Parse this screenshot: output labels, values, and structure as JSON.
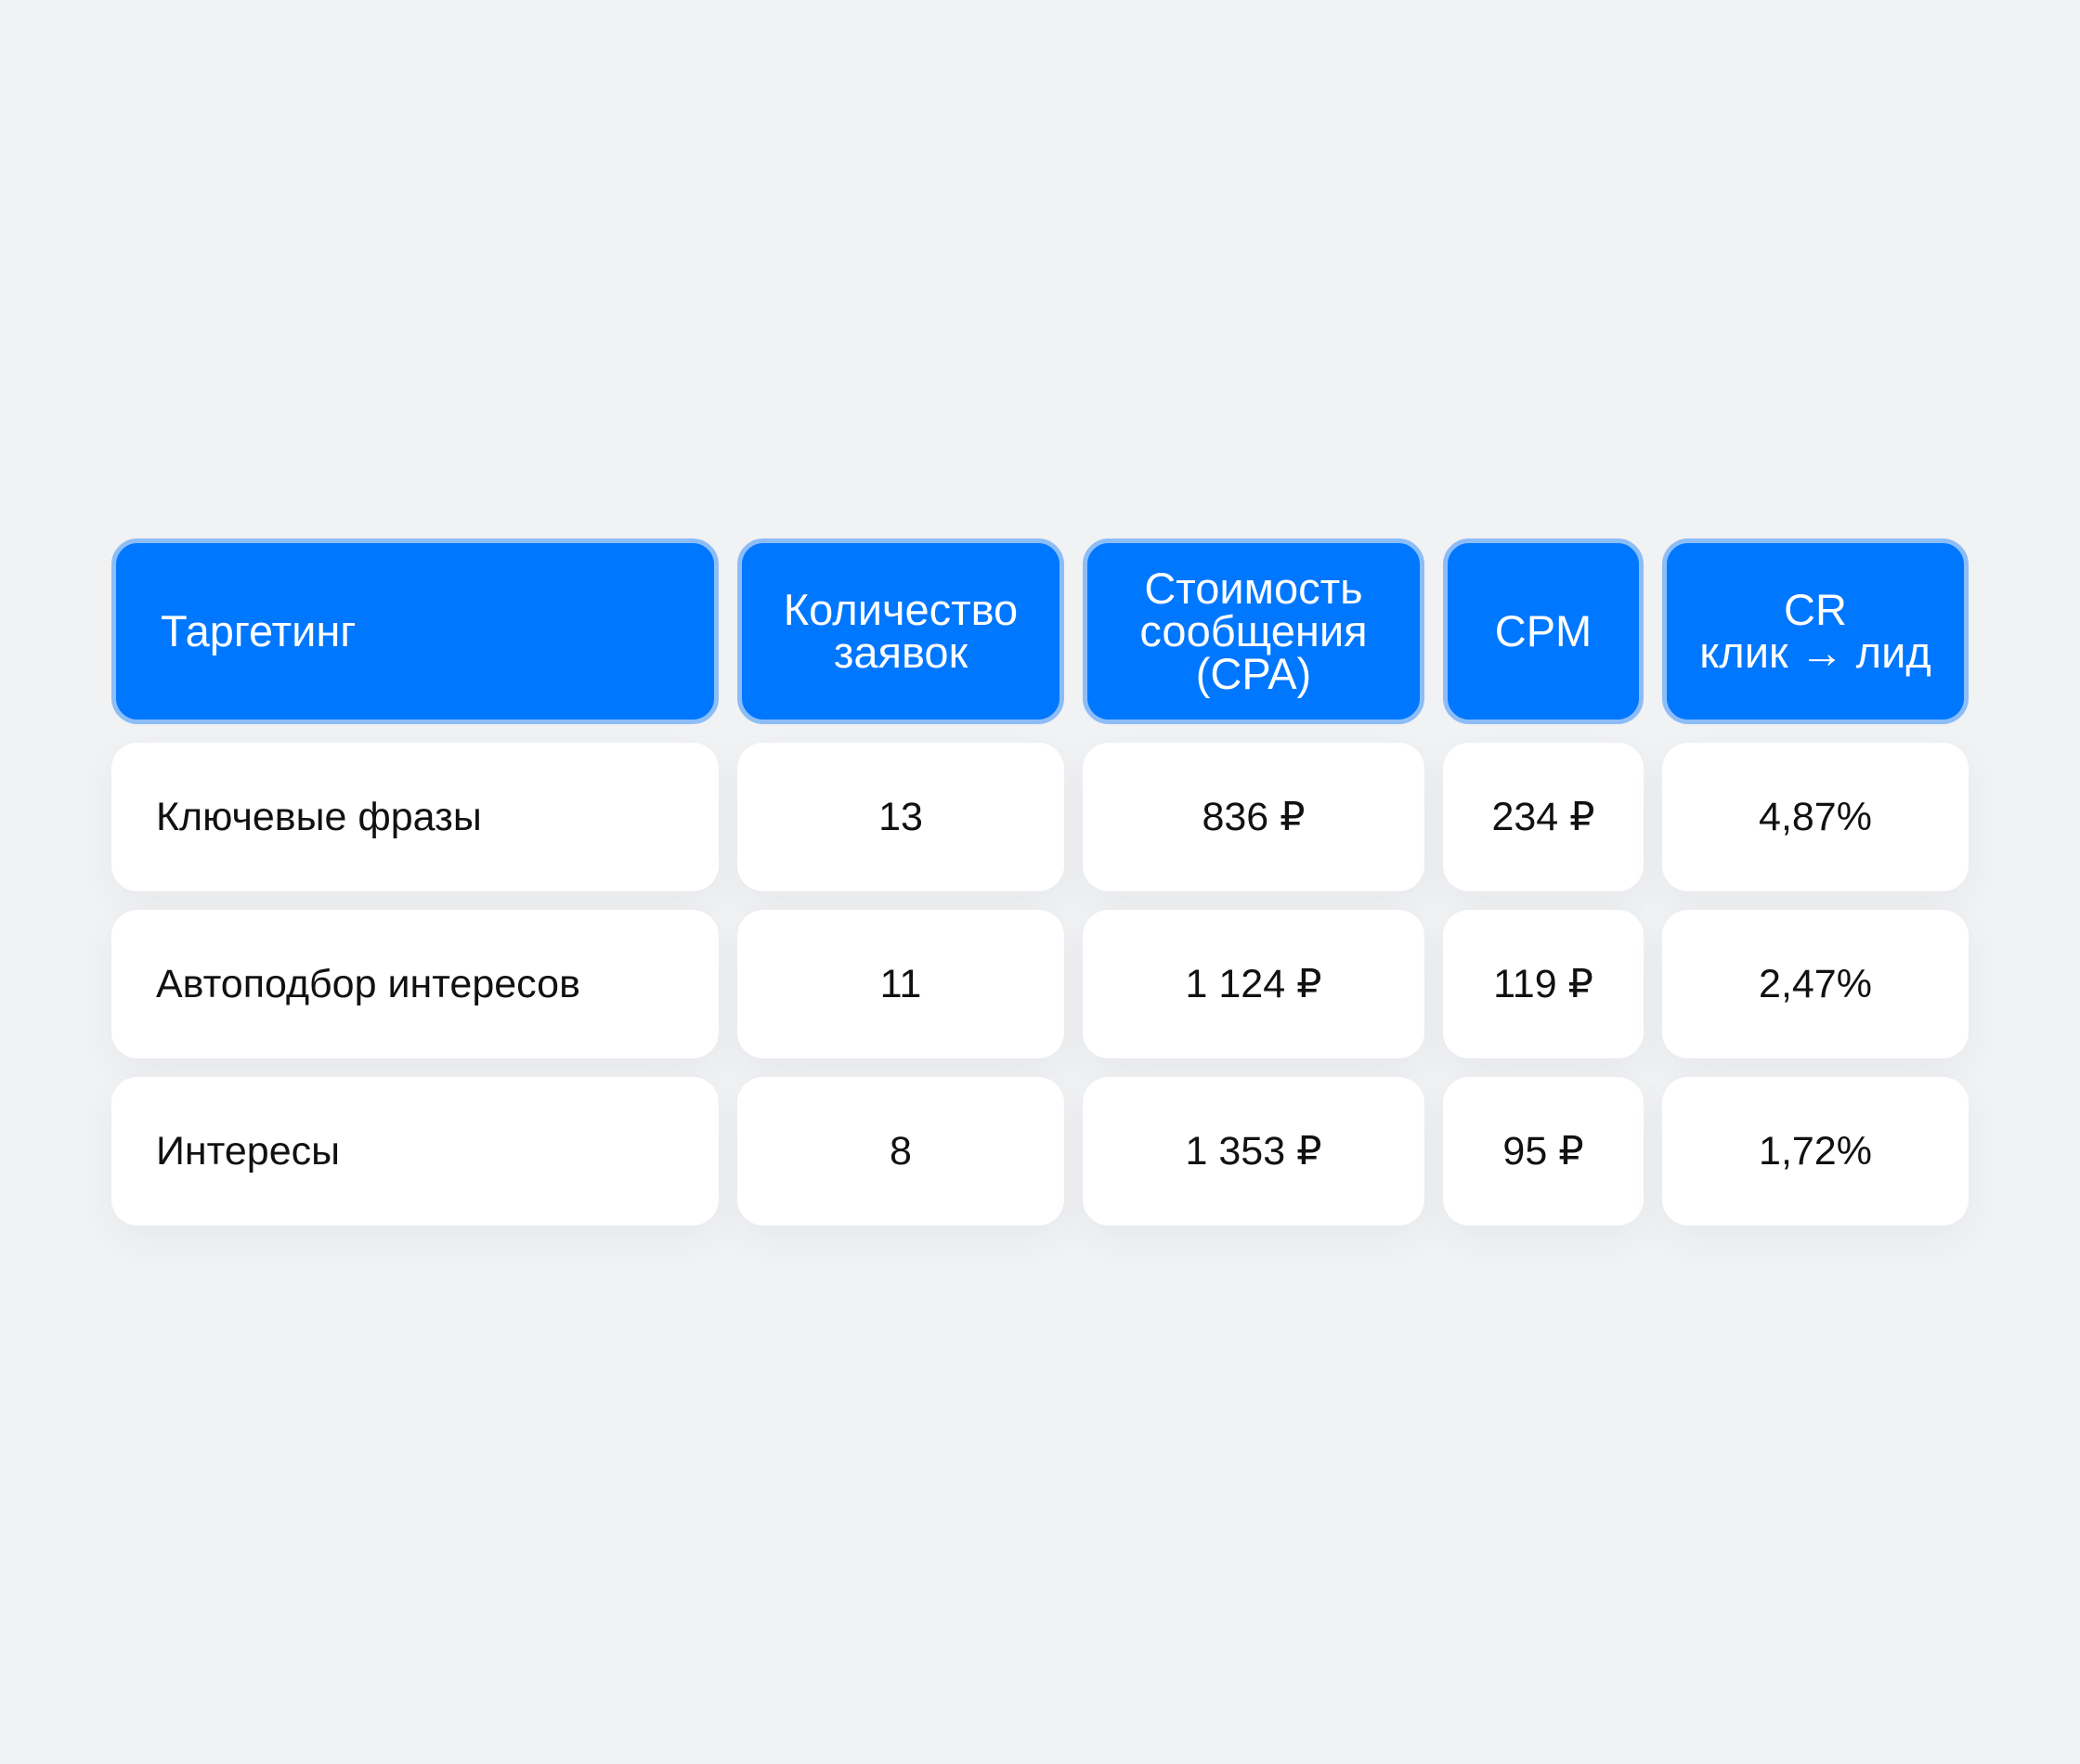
{
  "table": {
    "headers": [
      "Таргетинг",
      "Количество\nзаявок",
      "Стоимость\nсообщения\n(CPA)",
      "CPM",
      "CR\nклик → лид"
    ],
    "rows": [
      [
        "Ключевые фразы",
        "13",
        "836 ₽",
        "234 ₽",
        "4,87%"
      ],
      [
        "Автоподбор интересов",
        "11",
        "1 124 ₽",
        "119 ₽",
        "2,47%"
      ],
      [
        "Интересы",
        "8",
        "1 353 ₽",
        "95 ₽",
        "1,72%"
      ]
    ]
  },
  "colors": {
    "header_bg": "#0077ff",
    "header_border": "#8dbdf7",
    "cell_bg": "#ffffff",
    "page_bg": "#f1f2f4"
  }
}
